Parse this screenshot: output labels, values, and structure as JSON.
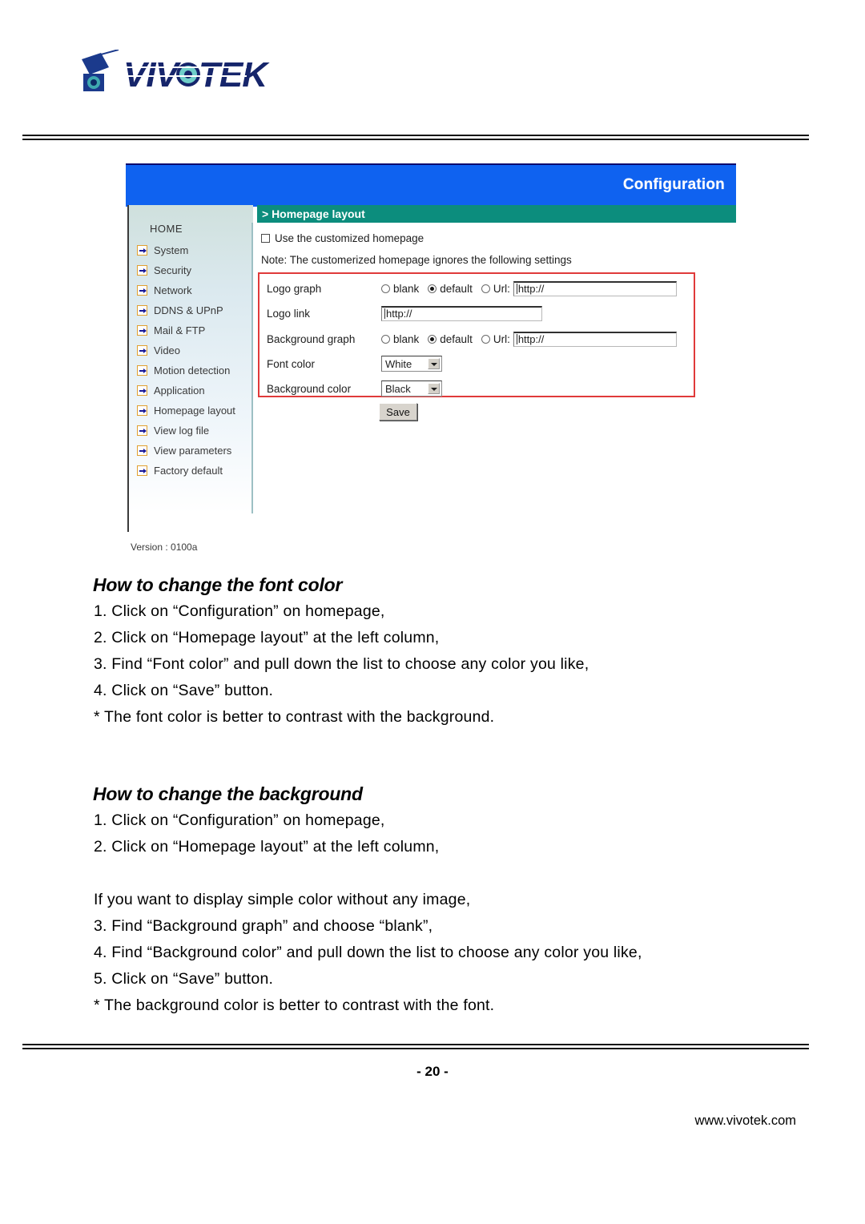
{
  "brand": {
    "logo_text": "VIVOTEK",
    "logo_icon": "vivotek-camera-logo"
  },
  "screenshot": {
    "banner_title": "Configuration",
    "section_title": "> Homepage layout",
    "checkbox_label": "Use the customized homepage",
    "checkbox_checked": false,
    "note": "Note: The customerized homepage ignores the following settings",
    "nav": {
      "home_label": "HOME",
      "items": [
        {
          "label": "System"
        },
        {
          "label": "Security"
        },
        {
          "label": "Network"
        },
        {
          "label": "DDNS & UPnP"
        },
        {
          "label": "Mail & FTP"
        },
        {
          "label": "Video"
        },
        {
          "label": "Motion detection"
        },
        {
          "label": "Application"
        },
        {
          "label": "Homepage layout"
        },
        {
          "label": "View log file"
        },
        {
          "label": "View parameters"
        },
        {
          "label": "Factory default"
        }
      ],
      "version": "Version : 0100a"
    },
    "form": {
      "logo_graph": {
        "label": "Logo graph",
        "option_blank": "blank",
        "option_default": "default",
        "option_url": "Url:",
        "selected": "default",
        "url_value": "http://"
      },
      "logo_link": {
        "label": "Logo link",
        "value": "http://"
      },
      "background_graph": {
        "label": "Background graph",
        "option_blank": "blank",
        "option_default": "default",
        "option_url": "Url:",
        "selected": "default",
        "url_value": "http://"
      },
      "font_color": {
        "label": "Font color",
        "value": "White"
      },
      "background_color": {
        "label": "Background color",
        "value": "Black"
      },
      "save_label": "Save"
    },
    "colors": {
      "banner_blue": "#0f62f0",
      "section_teal": "#0c8d7d",
      "highlight_red": "#e03a3a"
    }
  },
  "sections": [
    {
      "heading": "How to change the font color",
      "lines": [
        "1. Click on “Configuration” on homepage,",
        "2. Click on “Homepage layout” at the left column,",
        "3. Find “Font color” and pull down the list to choose any color you like,",
        "4. Click on “Save” button.",
        "*  The font color is better to contrast with the background."
      ]
    },
    {
      "heading": "How to change the background",
      "lines": [
        "1. Click on “Configuration” on homepage,",
        "2. Click on “Homepage layout” at the left column,",
        "",
        "If you want to display simple color without any image,",
        "3. Find “Background graph” and choose “blank”,",
        "4. Find “Background color” and pull down the list to choose any color you like,",
        "5. Click on “Save” button.",
        "*  The background color is better to contrast with the font."
      ]
    }
  ],
  "footer": {
    "page_number": "- 20 -",
    "website": "www.vivotek.com"
  }
}
